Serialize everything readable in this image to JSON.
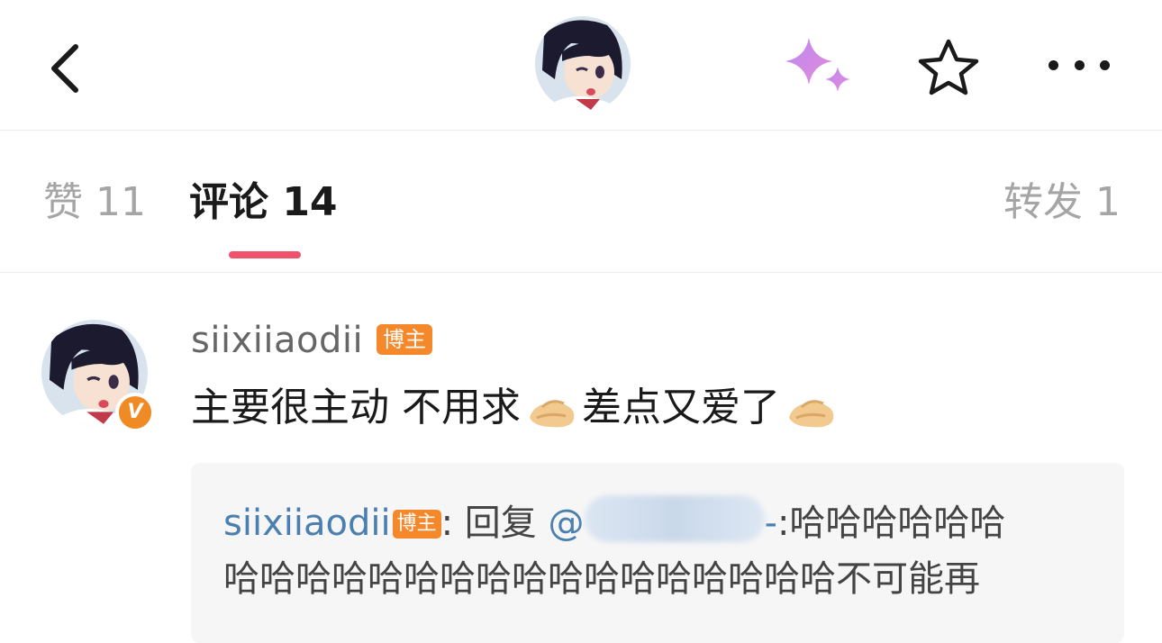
{
  "header": {
    "back_icon": "chevron-left-icon",
    "avatar_icon": "anime-girl-avatar",
    "sparkle_icon": "sparkle-icon",
    "star_icon": "star-outline-icon",
    "more_icon": "more-horizontal-icon"
  },
  "tabs": {
    "likes_label": "赞 11",
    "comments_label": "评论 14",
    "reposts_label": "转发 1",
    "active": "comments",
    "accent_color": "#f0516b"
  },
  "comment": {
    "username": "siixiiaodii",
    "badge": "博主",
    "verified_badge": "V",
    "text_part1": "主要很主动 不用求",
    "text_part2": "差点又爱了",
    "emoji_icon": "pinched-hands-emoji"
  },
  "reply": {
    "username": "siixiiaodii",
    "badge": "博主",
    "prefix": ": 回复 ",
    "mention_at": "@",
    "mention_tail": "-",
    "text_line1": ":哈哈哈哈哈哈",
    "text_line2": "哈哈哈哈哈哈哈哈哈哈哈哈哈哈哈哈哈不可能再"
  },
  "colors": {
    "badge_orange": "#f5882a",
    "link_blue": "#4a7fb0",
    "muted_gray": "#a5a5a5"
  }
}
